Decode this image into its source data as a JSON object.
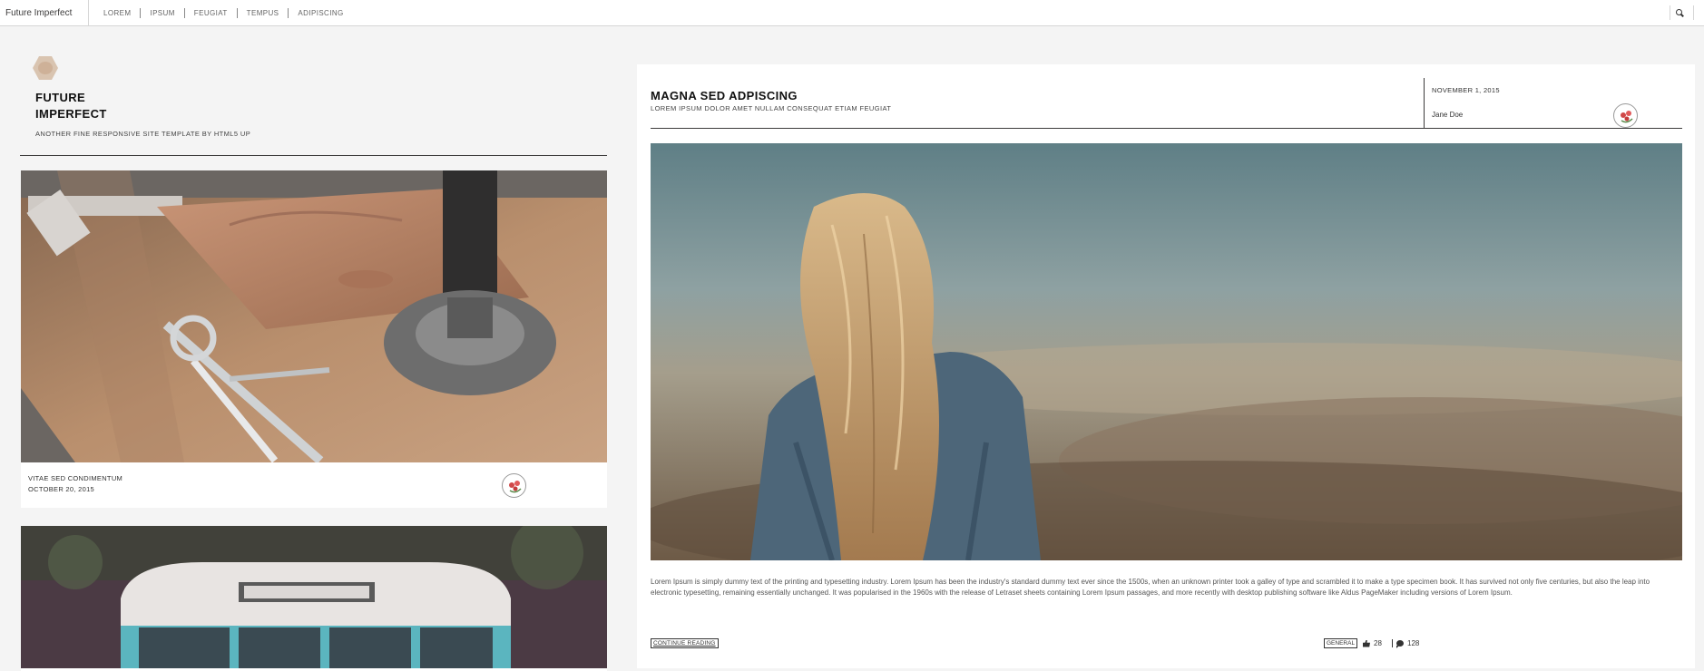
{
  "header": {
    "brand": "Future Imperfect",
    "nav": [
      "LOREM",
      "IPSUM",
      "FEUGIAT",
      "TEMPUS",
      "ADIPISCING"
    ]
  },
  "intro": {
    "title_line1": "FUTURE",
    "title_line2": "IMPERFECT",
    "subtitle": "ANOTHER FINE RESPONSIVE SITE TEMPLATE BY HTML5 UP"
  },
  "mini_posts": [
    {
      "title": "VITAE SED CONDIMENTUM",
      "date": "OCTOBER 20, 2015"
    }
  ],
  "post": {
    "title": "MAGNA SED ADPISCING",
    "subtitle": "LOREM IPSUM DOLOR AMET NULLAM CONSEQUAT ETIAM FEUGIAT",
    "date": "NOVEMBER 1, 2015",
    "author": "Jane Doe",
    "body": "Lorem Ipsum is simply dummy text of the printing and typesetting industry. Lorem Ipsum has been the industry's standard dummy text ever since the 1500s, when an unknown printer took a galley of type and scrambled it to make a type specimen book. It has survived not only five centuries, but also the leap into electronic typesetting, remaining essentially unchanged. It was popularised in the 1960s with the release of Letraset sheets containing Lorem Ipsum passages, and more recently with desktop publishing software like Aldus PageMaker including versions of Lorem Ipsum.",
    "continue_label": "CONTINUE READING",
    "category": "GENERAL",
    "likes": "28",
    "comments": "128"
  },
  "icons": {
    "search": "search-icon",
    "likes": "thumbs-up-icon",
    "comments": "comment-icon"
  },
  "colors": {
    "page_bg": "#f4f4f4",
    "card_bg": "#ffffff",
    "text": "#3c3b3b"
  }
}
